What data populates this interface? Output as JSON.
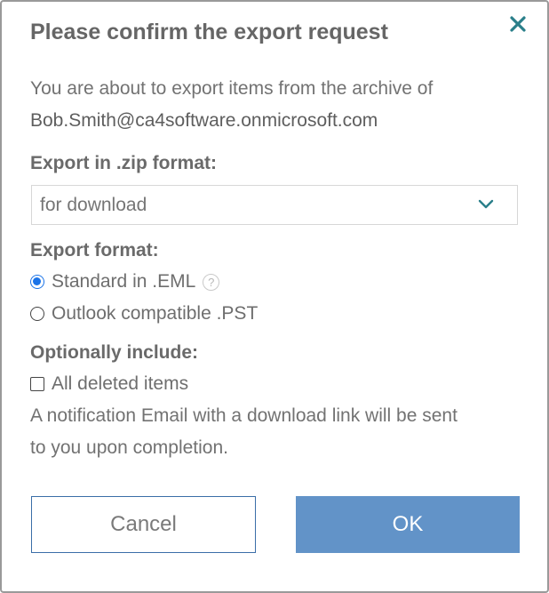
{
  "dialog": {
    "title": "Please confirm the export request",
    "message_line1": "You are about to export items from the archive of",
    "email": "Bob.Smith@ca4software.onmicrosoft.com",
    "zip_label": "Export in .zip format:",
    "zip_select": {
      "selected": "for download"
    },
    "format_label": "Export format:",
    "format_options": [
      {
        "label": "Standard in .EML",
        "checked": true
      },
      {
        "label": "Outlook compatible .PST",
        "checked": false
      }
    ],
    "help_glyph": "?",
    "include_label": "Optionally include:",
    "include_options": [
      {
        "label": "All deleted items",
        "checked": false
      }
    ],
    "notice_line1": "A notification Email with a download link will be sent",
    "notice_line2": "to you upon completion.",
    "cancel_label": "Cancel",
    "ok_label": "OK",
    "colors": {
      "accent": "#6293c8",
      "close_icon": "#2a7f8a",
      "radio_checked": "#1a73e8"
    },
    "icons": {
      "close": "close-icon",
      "dropdown": "chevron-down-icon",
      "help": "help-icon"
    }
  }
}
